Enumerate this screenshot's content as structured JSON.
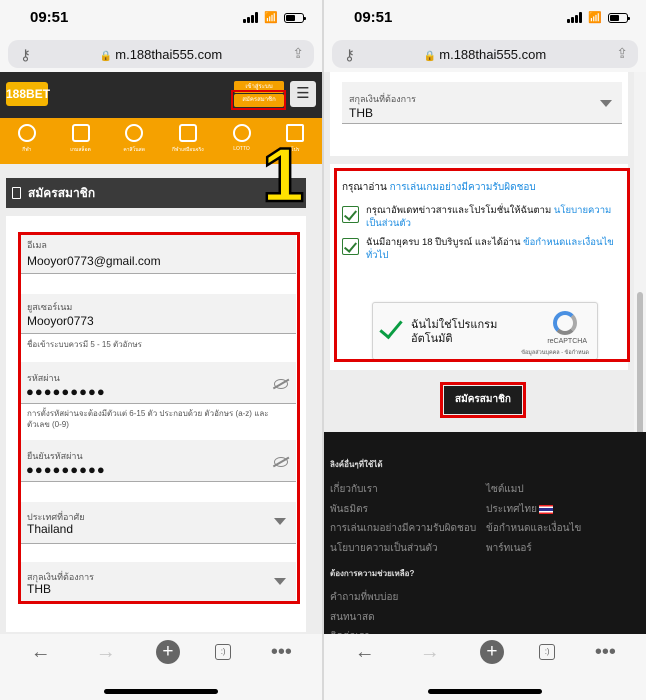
{
  "status": {
    "time": "09:51"
  },
  "browser": {
    "url": "m.188thai555.com"
  },
  "site": {
    "logo": "188BET",
    "login_label": "เข้าสู่ระบบ",
    "register_label": "สมัครสมาชิก",
    "nav": [
      {
        "label": "กีฬา",
        "icon": "soccer-icon"
      },
      {
        "label": "เกมสล็อต",
        "icon": "slot-icon"
      },
      {
        "label": "คาสิโนสด",
        "icon": "casino-chip-icon"
      },
      {
        "label": "กีฬาเสมือนจริง",
        "icon": "virtual-sports-icon"
      },
      {
        "label": "LOTTO",
        "icon": "lotto-icon"
      },
      {
        "label": "โปร",
        "icon": "gift-icon"
      }
    ]
  },
  "annotation": {
    "step": "1"
  },
  "form": {
    "title": "สมัครสมาชิก",
    "email_label": "อีเมล",
    "email_value": "Mooyor0773@gmail.com",
    "username_label": "ยูสเซอร์เนม",
    "username_value": "Mooyor0773",
    "username_hint": "ชื่อเข้าระบบควรมี 5 - 15 ตัวอักษร",
    "password_label": "รหัสผ่าน",
    "password_value": "●●●●●●●●●",
    "password_hint": "การตั้งรหัสผ่านจะต้องมีตัวแต่ 6-15 ตัว ประกอบด้วย ตัวอักษร (a-z) และ ตัวเลข (0-9)",
    "confirm_label": "ยืนยันรหัสผ่าน",
    "confirm_value": "●●●●●●●●●",
    "country_label": "ประเทศที่อาศัย",
    "country_value": "Thailand",
    "currency_label": "สกุลเงินที่ต้องการ",
    "currency_value": "THB"
  },
  "terms": {
    "lead": "กรุณาอ่าน",
    "lead_link": "การเล่นเกมอย่างมีความรับผิดชอบ",
    "promo_text": "กรุณาอัพเดทข่าวสารและโปรโมชั่นให้ฉันตาม",
    "promo_link": "นโยบายความเป็นส่วนตัว",
    "age_text": "ฉันมีอายุครบ 18 ปีบริบูรณ์ และได้อ่าน",
    "age_link": "ข้อกำหนดและเงื่อนไขทั่วไป"
  },
  "recaptcha": {
    "line1": "ฉันไม่ใช่โปรแกรม",
    "line2": "อัตโนมัติ",
    "brand": "reCAPTCHA",
    "links": "ข้อมูลส่วนบุคคล - ข้อกำหนด"
  },
  "submit_label": "สมัครสมาชิก",
  "footer": {
    "links_heading": "ลิงค์อื่นๆที่ใช้ได้",
    "col1": [
      "เกี่ยวกับเรา",
      "พันธมิตร",
      "การเล่นเกมอย่างมีความรับผิดชอบ",
      "นโยบายความเป็นส่วนตัว"
    ],
    "col2": [
      "ไซต์แมป",
      "ประเทศไทย",
      "ข้อกำหนดและเงื่อนไข",
      "พาร์ทเนอร์"
    ],
    "help_heading": "ต้องการความช่วยเหลือ?",
    "help_links": [
      "คำถามที่พบบ่อย",
      "สนทนาสด",
      "ติดต่อเรา"
    ]
  },
  "colors": {
    "accent": "#f5a100",
    "highlight": "#e00000",
    "link": "#1b8be0",
    "header": "#2a2a2a"
  }
}
